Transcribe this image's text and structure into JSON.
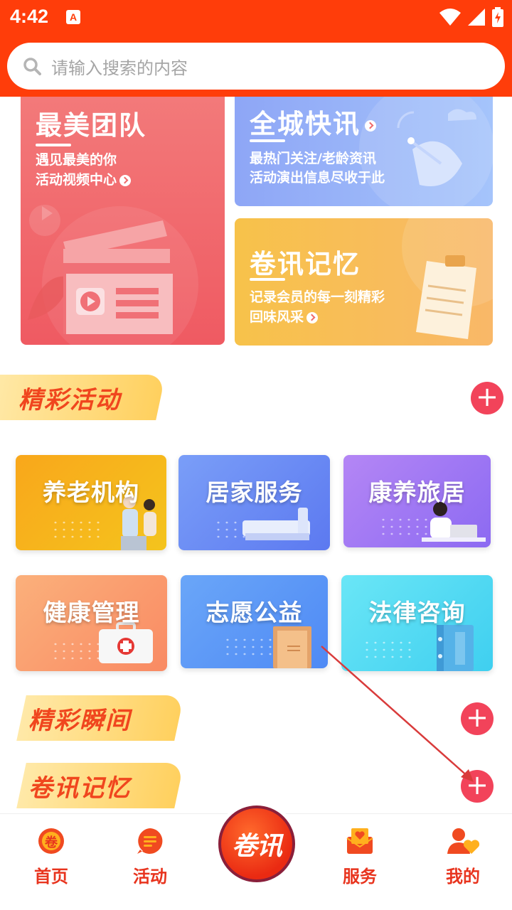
{
  "status": {
    "time": "4:42",
    "notif": "A"
  },
  "search": {
    "placeholder": "请输入搜索的内容"
  },
  "banners": {
    "team": {
      "title": "最美团队",
      "line1": "遇见最美的你",
      "line2": "活动视频中心"
    },
    "news": {
      "title": "全城快讯",
      "line1": "最热门关注/老龄资讯",
      "line2": "活动演出信息尽收于此"
    },
    "memory": {
      "title": "卷讯记忆",
      "line1": "记录会员的每一刻精彩",
      "line2": "回味风采"
    }
  },
  "sections": {
    "activities": {
      "label": "精彩活动",
      "add": "+"
    },
    "moments": {
      "label": "精彩瞬间",
      "add": "+"
    },
    "memory": {
      "label": "卷讯记忆",
      "add": "+"
    }
  },
  "services": [
    {
      "label": "养老机构",
      "color": "#f5b21d"
    },
    {
      "label": "居家服务",
      "color": "#6f93f5"
    },
    {
      "label": "康养旅居",
      "color": "#a47cf3"
    },
    {
      "label": "健康管理",
      "color": "#fb9a6c"
    },
    {
      "label": "志愿公益",
      "color": "#5d98f6"
    },
    {
      "label": "法律咨询",
      "color": "#50d9f3"
    }
  ],
  "nav": {
    "home": "首页",
    "activity": "活动",
    "center": "卷讯",
    "service": "服务",
    "mine": "我的",
    "home_badge": "卷"
  },
  "colors": {
    "header": "#ff3d0a",
    "accent": "#e8341e",
    "plus": "#f2435a"
  }
}
